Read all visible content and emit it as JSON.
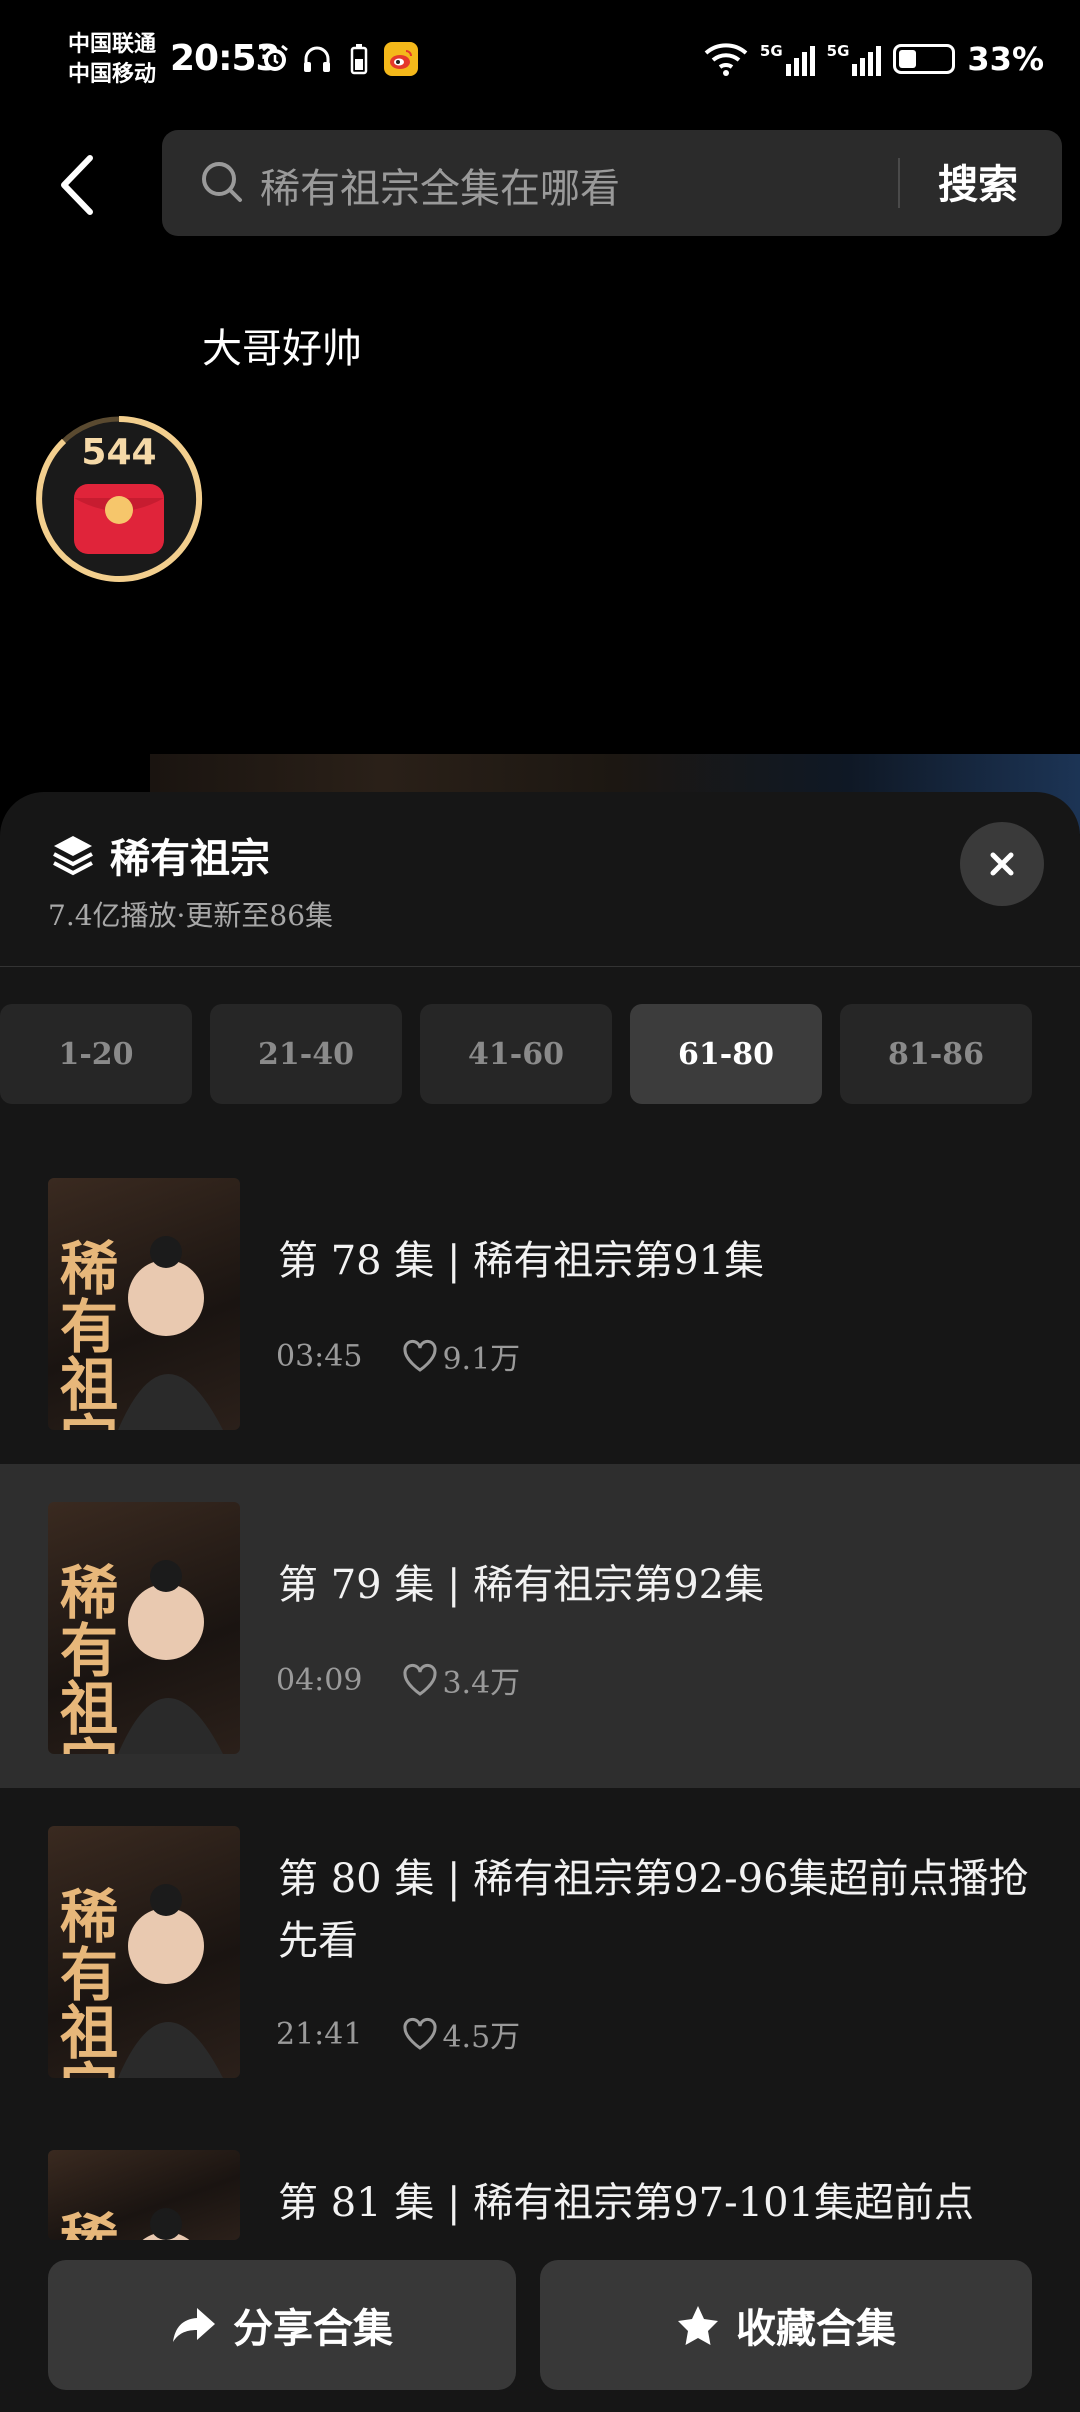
{
  "status_bar": {
    "carrier1": "中国联通",
    "carrier2": "中国移动",
    "time": "20:53",
    "sig_label": "5G",
    "battery": "33%",
    "battery_level": 0.33
  },
  "search": {
    "placeholder": "稀有祖宗全集在哪看",
    "button": "搜索"
  },
  "author": "大哥好帅",
  "coin_count": "544",
  "collection": {
    "title": "稀有祖宗",
    "subtitle": "7.4亿播放·更新至86集"
  },
  "tabs": [
    "1-20",
    "21-40",
    "41-60",
    "61-80",
    "81-86"
  ],
  "active_tab": 3,
  "thumb_text": "稀有祖宗",
  "episodes": [
    {
      "title": "第 78 集 | 稀有祖宗第91集",
      "duration": "03:45",
      "likes": "9.1万"
    },
    {
      "title": "第 79 集 | 稀有祖宗第92集",
      "duration": "04:09",
      "likes": "3.4万"
    },
    {
      "title": "第 80 集 | 稀有祖宗第92-96集超前点播抢先看",
      "duration": "21:41",
      "likes": "4.5万"
    },
    {
      "title": "第 81 集 | 稀有祖宗第97-101集超前点",
      "duration": "",
      "likes": ""
    }
  ],
  "bottom": {
    "share": "分享合集",
    "favorite": "收藏合集"
  }
}
